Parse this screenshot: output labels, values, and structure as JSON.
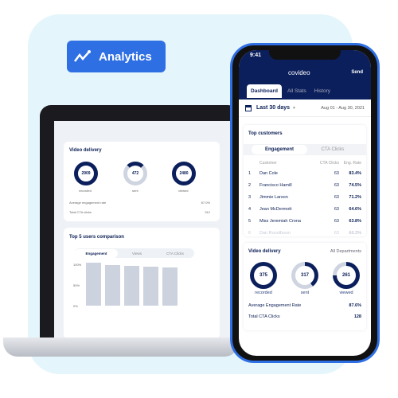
{
  "badge": {
    "label": "Analytics",
    "icon": "chart-trend-icon",
    "color": "#2f6fe4"
  },
  "laptop": {
    "video_delivery": {
      "title": "Video delivery",
      "rings": [
        {
          "value": "2909",
          "label": "recorded"
        },
        {
          "value": "472",
          "label": "sent"
        },
        {
          "value": "2480",
          "label": "viewed"
        }
      ],
      "avg_label": "Average engagement rate",
      "avg_value": "87.0%",
      "cta_label": "Total CTA clicks",
      "cta_value": "912"
    },
    "comparison": {
      "title": "Top 5 users comparison",
      "tabs": [
        "Engagement",
        "Views",
        "CTA Clicks"
      ],
      "yticks": [
        "100%",
        "50%",
        "0%"
      ]
    }
  },
  "phone": {
    "time": "9:41",
    "brand": "covideo",
    "send": "Send",
    "tabs": [
      "Dashboard",
      "All Stats",
      "History"
    ],
    "range": "Last 30 days",
    "dates": "Aug 01 - Aug 30, 2021",
    "top_customers": {
      "title": "Top customers",
      "tabs": [
        "Engagement",
        "CTA Clicks"
      ],
      "headers": [
        "Customer",
        "CTA Clicks",
        "Eng. Rate"
      ],
      "rows": [
        [
          "1",
          "Dan Cole",
          "63",
          "83.4%"
        ],
        [
          "2",
          "Francisco Hamill",
          "63",
          "74.5%"
        ],
        [
          "3",
          "Jimmie Larson",
          "63",
          "71.2%"
        ],
        [
          "4",
          "Jean McDermott",
          "63",
          "64.6%"
        ],
        [
          "5",
          "Miss Jeremiah Crona",
          "63",
          "63.8%"
        ],
        [
          "6",
          "Dan Runolfsson",
          "63",
          "60.3%"
        ]
      ]
    },
    "video_delivery": {
      "title": "Video delivery",
      "filter": "All Departments",
      "rings": [
        {
          "value": "375",
          "label": "recorded",
          "fill": 1
        },
        {
          "value": "317",
          "label": "sent",
          "fill": 0.4
        },
        {
          "value": "261",
          "label": "viewed",
          "fill": 0.75
        }
      ],
      "avg_label": "Average Engagement Rate",
      "avg_value": "87.6%",
      "cta_label": "Total CTA Clicks",
      "cta_value": "128"
    }
  }
}
